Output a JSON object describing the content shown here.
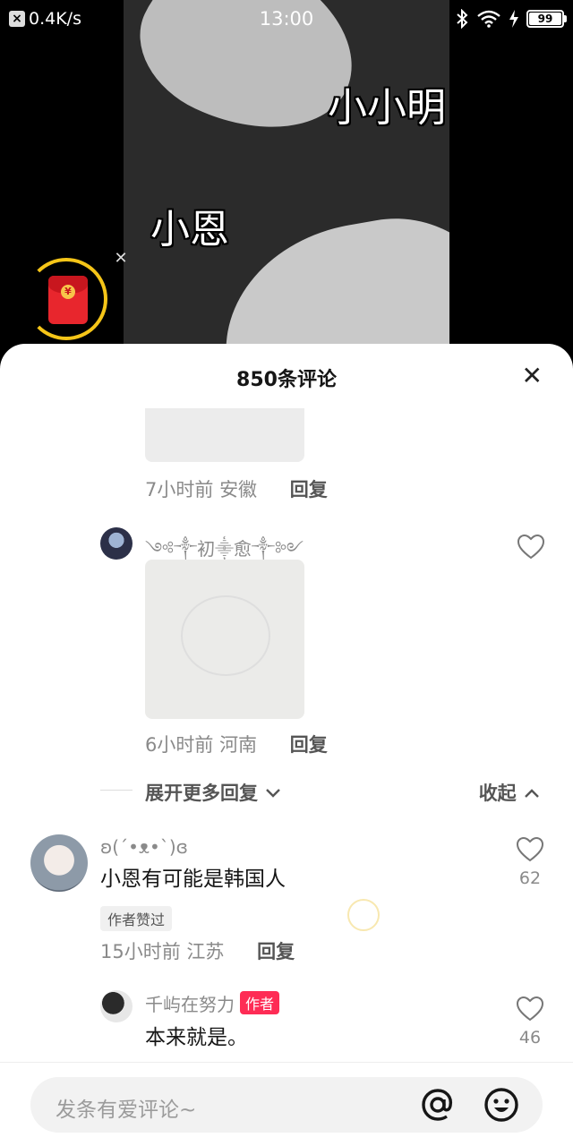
{
  "status_bar": {
    "network_speed": "0.4K/s",
    "time": "13:00",
    "battery": "99"
  },
  "video": {
    "overlay_text_1": "小小明",
    "overlay_text_2": "小恩"
  },
  "comments_sheet": {
    "title": "850条评论",
    "items": [
      {
        "time": "7小时前",
        "location": "安徽",
        "reply_label": "回复"
      },
      {
        "username": "༺༒初⸎愈༒༻",
        "time": "6小时前",
        "location": "河南",
        "reply_label": "回复"
      },
      {
        "username": "ʚ(´•ᴥ•`)ɞ",
        "text": "小恩有可能是韩国人",
        "badge": "作者赞过",
        "time": "15小时前",
        "location": "江苏",
        "reply_label": "回复",
        "likes": "62"
      },
      {
        "username": "千屿在努力",
        "author_tag": "作者",
        "text": "本来就是。",
        "likes": "46"
      }
    ],
    "expand_more": "展开更多回复",
    "collapse": "收起"
  },
  "input": {
    "placeholder": "发条有爱评论~"
  },
  "icons": [
    "close-icon",
    "heart-icon",
    "at-icon",
    "emoji-icon",
    "red-packet-icon",
    "bluetooth-icon",
    "wifi-icon",
    "charging-icon"
  ],
  "colors": {
    "accent": "#fe2c55",
    "packet_ring": "#f5c518",
    "packet_red": "#e8262d"
  }
}
